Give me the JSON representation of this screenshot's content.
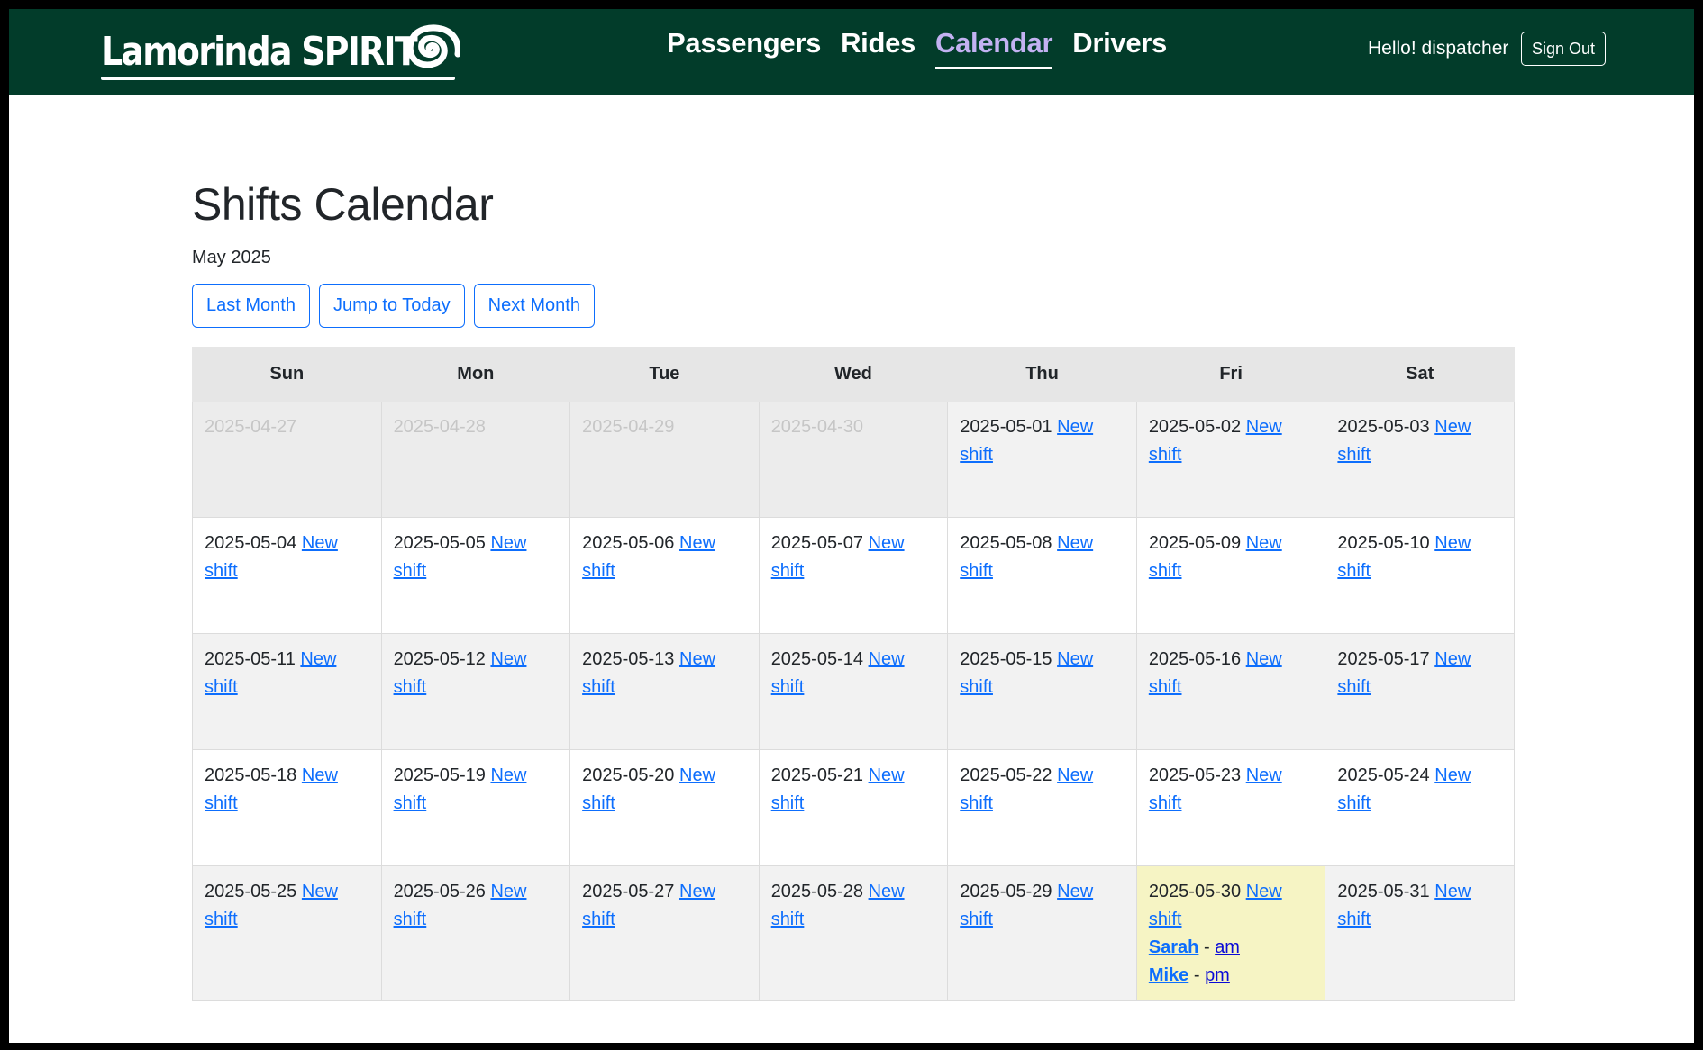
{
  "navbar": {
    "brand": "Lamorinda SPIRIT",
    "links": [
      {
        "label": "Passengers",
        "active": false
      },
      {
        "label": "Rides",
        "active": false
      },
      {
        "label": "Calendar",
        "active": true
      },
      {
        "label": "Drivers",
        "active": false
      }
    ],
    "greeting": "Hello! dispatcher",
    "sign_out": "Sign Out",
    "colors": {
      "background": "#023c2a",
      "active_link": "#c3b2f2"
    }
  },
  "main": {
    "title": "Shifts Calendar",
    "month_label": "May 2025",
    "buttons": {
      "last_month": "Last Month",
      "jump_today": "Jump to Today",
      "next_month": "Next Month"
    },
    "new_shift_label": "New shift"
  },
  "calendar": {
    "weekdays": [
      "Sun",
      "Mon",
      "Tue",
      "Wed",
      "Thu",
      "Fri",
      "Sat"
    ],
    "weeks": [
      [
        {
          "date": "2025-04-27",
          "other": true
        },
        {
          "date": "2025-04-28",
          "other": true
        },
        {
          "date": "2025-04-29",
          "other": true
        },
        {
          "date": "2025-04-30",
          "other": true
        },
        {
          "date": "2025-05-01"
        },
        {
          "date": "2025-05-02"
        },
        {
          "date": "2025-05-03"
        }
      ],
      [
        {
          "date": "2025-05-04"
        },
        {
          "date": "2025-05-05"
        },
        {
          "date": "2025-05-06"
        },
        {
          "date": "2025-05-07"
        },
        {
          "date": "2025-05-08"
        },
        {
          "date": "2025-05-09"
        },
        {
          "date": "2025-05-10"
        }
      ],
      [
        {
          "date": "2025-05-11"
        },
        {
          "date": "2025-05-12"
        },
        {
          "date": "2025-05-13"
        },
        {
          "date": "2025-05-14"
        },
        {
          "date": "2025-05-15"
        },
        {
          "date": "2025-05-16"
        },
        {
          "date": "2025-05-17"
        }
      ],
      [
        {
          "date": "2025-05-18"
        },
        {
          "date": "2025-05-19"
        },
        {
          "date": "2025-05-20"
        },
        {
          "date": "2025-05-21"
        },
        {
          "date": "2025-05-22"
        },
        {
          "date": "2025-05-23"
        },
        {
          "date": "2025-05-24"
        }
      ],
      [
        {
          "date": "2025-05-25"
        },
        {
          "date": "2025-05-26"
        },
        {
          "date": "2025-05-27"
        },
        {
          "date": "2025-05-28"
        },
        {
          "date": "2025-05-29"
        },
        {
          "date": "2025-05-30",
          "today": true,
          "shifts": [
            {
              "driver": "Sarah",
              "period": "am"
            },
            {
              "driver": "Mike",
              "period": "pm"
            }
          ]
        },
        {
          "date": "2025-05-31"
        }
      ]
    ],
    "colors": {
      "today": "#f6f4c4",
      "link": "#0d6efd",
      "header_bg": "#e6e6e6"
    }
  }
}
